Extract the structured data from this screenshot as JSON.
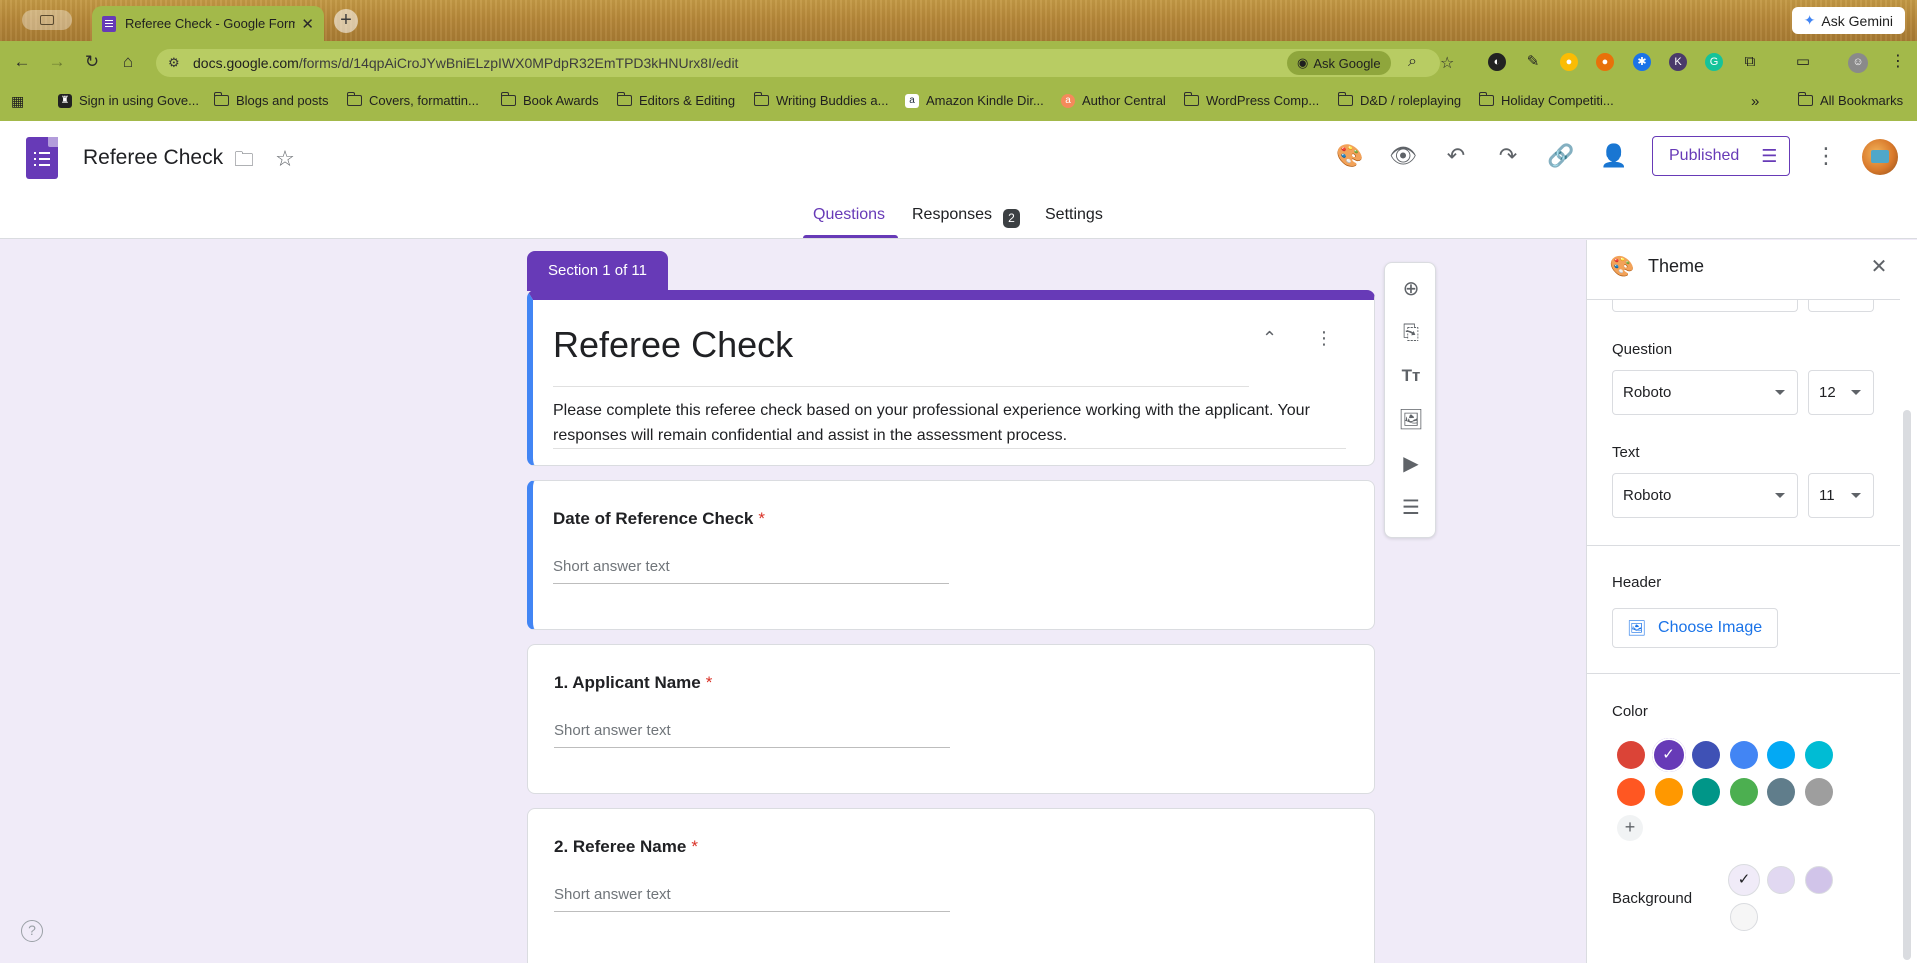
{
  "browser": {
    "tab_title": "Referee Check - Google Form",
    "ask_gemini": "Ask Gemini",
    "url_host": "docs.google.com",
    "url_path": "/forms/d/14qpAiCroJYwBniELzpIWX0MPdpR32EmTPD3kHNUrx8I/edit",
    "ask_google": "Ask Google",
    "bookmarks": [
      "Sign in using Gove...",
      "Blogs and posts",
      "Covers, formattin...",
      "Book Awards",
      "Editors & Editing",
      "Writing Buddies a...",
      "Amazon Kindle Dir...",
      "Author Central",
      "WordPress Comp...",
      "D&D / roleplaying",
      "Holiday Competiti..."
    ],
    "bookmarks_overflow": "»",
    "all_bookmarks": "All Bookmarks"
  },
  "header": {
    "doc_title": "Referee Check",
    "published_label": "Published"
  },
  "tabs": {
    "questions": "Questions",
    "responses": "Responses",
    "responses_count": "2",
    "settings": "Settings"
  },
  "form": {
    "section_label": "Section 1 of 11",
    "title": "Referee Check",
    "description": "Please complete this referee check based on your professional experience working with the applicant. Your responses will remain confidential and assist in the assessment process.",
    "questions": [
      {
        "title": "Date of Reference Check",
        "required": "*",
        "hint": "Short answer text"
      },
      {
        "title": "1. Applicant Name",
        "required": "*",
        "hint": "Short answer text"
      },
      {
        "title": "2. Referee Name",
        "required": "*",
        "hint": "Short answer text"
      }
    ]
  },
  "theme_panel": {
    "title": "Theme",
    "question_label": "Question",
    "question_font": "Roboto",
    "question_size": "12",
    "text_label": "Text",
    "text_font": "Roboto",
    "text_size": "11",
    "header_label": "Header",
    "choose_image": "Choose Image",
    "color_label": "Color",
    "colors": [
      "#db4437",
      "#673ab7",
      "#3f51b5",
      "#4285f4",
      "#03a9f4",
      "#00bcd4",
      "#ff5722",
      "#ff9800",
      "#009688",
      "#4caf50",
      "#607d8b",
      "#9e9e9e"
    ],
    "selected_color": "#673ab7",
    "add_color": "+",
    "background_label": "Background",
    "backgrounds": [
      "#f0ebf8",
      "#e1d8f1",
      "#d1c4e9",
      "#f6f6f6"
    ],
    "selected_background": "#f0ebf8"
  },
  "icons": {
    "check": "✓"
  }
}
